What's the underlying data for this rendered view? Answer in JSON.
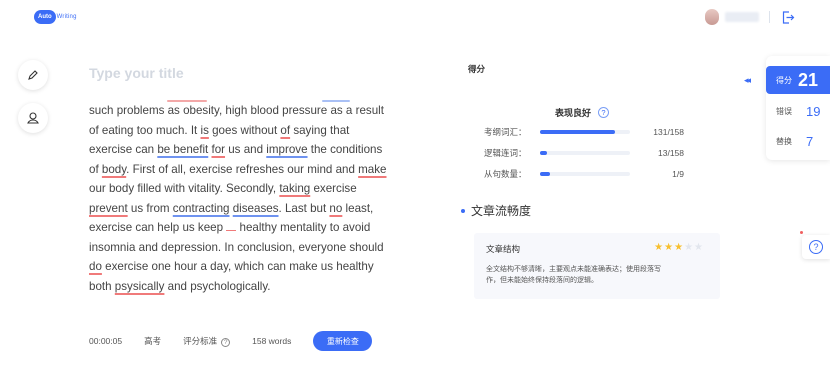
{
  "header": {
    "logo_badge": "Auto",
    "logo_text": "Writing"
  },
  "editor": {
    "title_placeholder": "Type your title",
    "lines": [
      [
        "such problems as obesity, high blood pressure as a result"
      ],
      [
        "of eating too much. It is goes without of saying that"
      ],
      [
        "exercise can be benefit for us and improve the conditions"
      ],
      [
        "of body. First of all, exercise refreshes our mind and make"
      ],
      [
        "our body filled with vitality. Secondly, taking exercise"
      ],
      [
        "prevent us from contracting diseases. Last but no least,"
      ],
      [
        "exercise can help us keep healthy mentality to avoid"
      ],
      [
        "insomnia and depression. In conclusion, everyone should"
      ],
      [
        "do exercise one hour a day, which can make us healthy"
      ],
      [
        "both psysically and psychologically."
      ]
    ]
  },
  "bottom_bar": {
    "timer": "00:00:05",
    "exam_type": "高考",
    "criteria_label": "评分标准",
    "help_glyph": "?",
    "word_count": "158 words",
    "recheck_label": "重新检查"
  },
  "score_section": {
    "heading": "得分",
    "performance_title": "表现良好",
    "help_glyph": "?",
    "metrics": [
      {
        "label": "考纲词汇：",
        "value": "131/158",
        "ratio": 0.83
      },
      {
        "label": "逻辑连词：",
        "value": "13/158",
        "ratio": 0.08
      },
      {
        "label": "从句数量：",
        "value": "1/9",
        "ratio": 0.11
      }
    ]
  },
  "fluency": {
    "heading": "文章流畅度",
    "card_title": "文章结构",
    "stars_filled": 3,
    "stars_total": 5,
    "description_line1": "全文结构不够清晰，主要观点未能准确表达；使用段落写",
    "description_line2": "作，但未能始终保持段落间的逻辑。"
  },
  "score_panel": {
    "collapse_glyph": "◂◂",
    "score_label": "得分",
    "score_value": "21",
    "errors_label": "错误",
    "errors_value": "19",
    "suggest_label": "替换",
    "suggest_value": "7"
  },
  "help_float": {
    "glyph": "?"
  },
  "colors": {
    "accent": "#3b6cf6",
    "error_underline": "#f07a7a",
    "suggest_underline": "#6f93f0",
    "star": "#f7bf2e"
  }
}
